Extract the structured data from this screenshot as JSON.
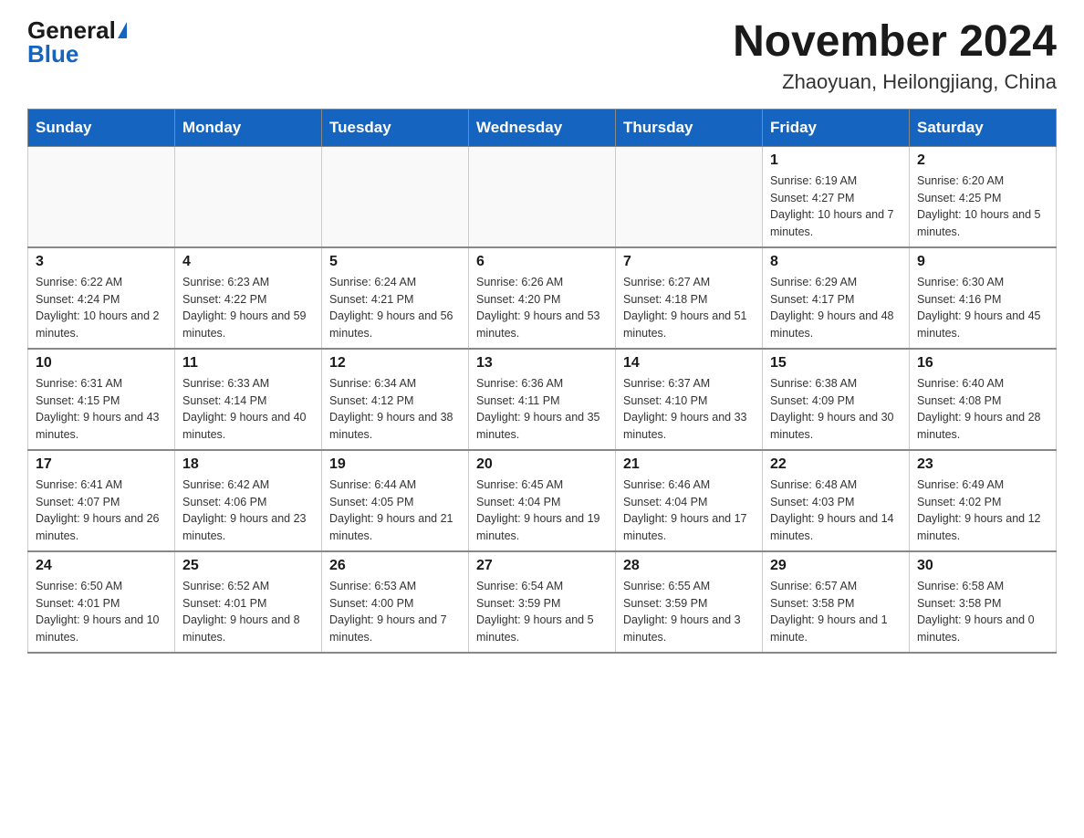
{
  "logo": {
    "general": "General",
    "blue": "Blue"
  },
  "title": "November 2024",
  "location": "Zhaoyuan, Heilongjiang, China",
  "days_of_week": [
    "Sunday",
    "Monday",
    "Tuesday",
    "Wednesday",
    "Thursday",
    "Friday",
    "Saturday"
  ],
  "weeks": [
    [
      {
        "day": "",
        "info": ""
      },
      {
        "day": "",
        "info": ""
      },
      {
        "day": "",
        "info": ""
      },
      {
        "day": "",
        "info": ""
      },
      {
        "day": "",
        "info": ""
      },
      {
        "day": "1",
        "info": "Sunrise: 6:19 AM\nSunset: 4:27 PM\nDaylight: 10 hours and 7 minutes."
      },
      {
        "day": "2",
        "info": "Sunrise: 6:20 AM\nSunset: 4:25 PM\nDaylight: 10 hours and 5 minutes."
      }
    ],
    [
      {
        "day": "3",
        "info": "Sunrise: 6:22 AM\nSunset: 4:24 PM\nDaylight: 10 hours and 2 minutes."
      },
      {
        "day": "4",
        "info": "Sunrise: 6:23 AM\nSunset: 4:22 PM\nDaylight: 9 hours and 59 minutes."
      },
      {
        "day": "5",
        "info": "Sunrise: 6:24 AM\nSunset: 4:21 PM\nDaylight: 9 hours and 56 minutes."
      },
      {
        "day": "6",
        "info": "Sunrise: 6:26 AM\nSunset: 4:20 PM\nDaylight: 9 hours and 53 minutes."
      },
      {
        "day": "7",
        "info": "Sunrise: 6:27 AM\nSunset: 4:18 PM\nDaylight: 9 hours and 51 minutes."
      },
      {
        "day": "8",
        "info": "Sunrise: 6:29 AM\nSunset: 4:17 PM\nDaylight: 9 hours and 48 minutes."
      },
      {
        "day": "9",
        "info": "Sunrise: 6:30 AM\nSunset: 4:16 PM\nDaylight: 9 hours and 45 minutes."
      }
    ],
    [
      {
        "day": "10",
        "info": "Sunrise: 6:31 AM\nSunset: 4:15 PM\nDaylight: 9 hours and 43 minutes."
      },
      {
        "day": "11",
        "info": "Sunrise: 6:33 AM\nSunset: 4:14 PM\nDaylight: 9 hours and 40 minutes."
      },
      {
        "day": "12",
        "info": "Sunrise: 6:34 AM\nSunset: 4:12 PM\nDaylight: 9 hours and 38 minutes."
      },
      {
        "day": "13",
        "info": "Sunrise: 6:36 AM\nSunset: 4:11 PM\nDaylight: 9 hours and 35 minutes."
      },
      {
        "day": "14",
        "info": "Sunrise: 6:37 AM\nSunset: 4:10 PM\nDaylight: 9 hours and 33 minutes."
      },
      {
        "day": "15",
        "info": "Sunrise: 6:38 AM\nSunset: 4:09 PM\nDaylight: 9 hours and 30 minutes."
      },
      {
        "day": "16",
        "info": "Sunrise: 6:40 AM\nSunset: 4:08 PM\nDaylight: 9 hours and 28 minutes."
      }
    ],
    [
      {
        "day": "17",
        "info": "Sunrise: 6:41 AM\nSunset: 4:07 PM\nDaylight: 9 hours and 26 minutes."
      },
      {
        "day": "18",
        "info": "Sunrise: 6:42 AM\nSunset: 4:06 PM\nDaylight: 9 hours and 23 minutes."
      },
      {
        "day": "19",
        "info": "Sunrise: 6:44 AM\nSunset: 4:05 PM\nDaylight: 9 hours and 21 minutes."
      },
      {
        "day": "20",
        "info": "Sunrise: 6:45 AM\nSunset: 4:04 PM\nDaylight: 9 hours and 19 minutes."
      },
      {
        "day": "21",
        "info": "Sunrise: 6:46 AM\nSunset: 4:04 PM\nDaylight: 9 hours and 17 minutes."
      },
      {
        "day": "22",
        "info": "Sunrise: 6:48 AM\nSunset: 4:03 PM\nDaylight: 9 hours and 14 minutes."
      },
      {
        "day": "23",
        "info": "Sunrise: 6:49 AM\nSunset: 4:02 PM\nDaylight: 9 hours and 12 minutes."
      }
    ],
    [
      {
        "day": "24",
        "info": "Sunrise: 6:50 AM\nSunset: 4:01 PM\nDaylight: 9 hours and 10 minutes."
      },
      {
        "day": "25",
        "info": "Sunrise: 6:52 AM\nSunset: 4:01 PM\nDaylight: 9 hours and 8 minutes."
      },
      {
        "day": "26",
        "info": "Sunrise: 6:53 AM\nSunset: 4:00 PM\nDaylight: 9 hours and 7 minutes."
      },
      {
        "day": "27",
        "info": "Sunrise: 6:54 AM\nSunset: 3:59 PM\nDaylight: 9 hours and 5 minutes."
      },
      {
        "day": "28",
        "info": "Sunrise: 6:55 AM\nSunset: 3:59 PM\nDaylight: 9 hours and 3 minutes."
      },
      {
        "day": "29",
        "info": "Sunrise: 6:57 AM\nSunset: 3:58 PM\nDaylight: 9 hours and 1 minute."
      },
      {
        "day": "30",
        "info": "Sunrise: 6:58 AM\nSunset: 3:58 PM\nDaylight: 9 hours and 0 minutes."
      }
    ]
  ]
}
